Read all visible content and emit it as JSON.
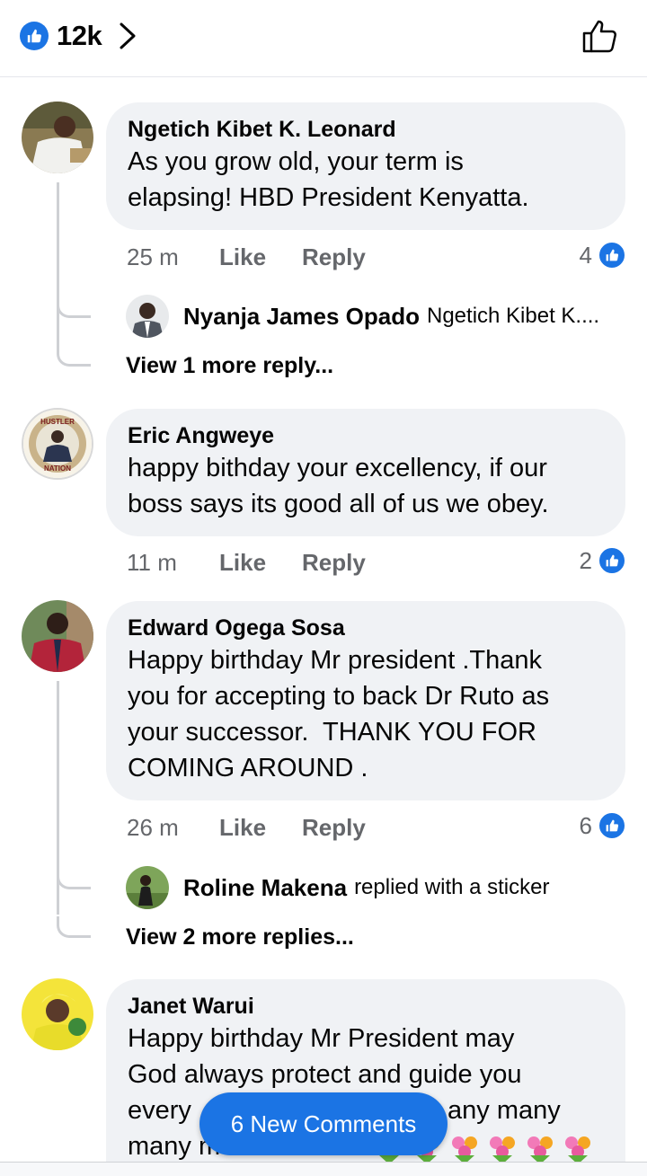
{
  "header": {
    "reaction_count": "12k",
    "like_icon": "like-thumb-icon",
    "chevron_icon": "chevron-right-icon",
    "like_button_icon": "thumb-up-outline-icon"
  },
  "colors": {
    "accent": "#1b74e4",
    "bubble": "#f0f2f5",
    "meta": "#65676b",
    "thread": "#ced0d4"
  },
  "comments": [
    {
      "author": "Ngetich Kibet K. Leonard",
      "lines": [
        "As you grow old, your term is",
        "elapsing! HBD President Kenyatta."
      ],
      "time": "25 m",
      "like": "Like",
      "reply": "Reply",
      "reactions": "4"
    },
    {
      "author": "Eric Angweye",
      "lines": [
        "happy bithday your excellency, if our",
        "boss says its good all of us we obey."
      ],
      "time": "11 m",
      "like": "Like",
      "reply": "Reply",
      "reactions": "2"
    },
    {
      "author": "Edward Ogega Sosa",
      "lines": [
        "Happy birthday Mr president .Thank",
        "you for accepting to back Dr Ruto as",
        "your successor.  THANK YOU FOR",
        "COMING AROUND ."
      ],
      "time": "26 m",
      "like": "Like",
      "reply": "Reply",
      "reactions": "6"
    },
    {
      "author": "Janet Warui",
      "lines": [
        "Happy birthday Mr President may",
        "God always protect and guide you",
        "every",
        "any many",
        "many more cheers"
      ]
    }
  ],
  "replies": [
    {
      "name": "Nyanja James Opado",
      "snippet": "Ngetich Kibet K...."
    },
    {
      "name": "Roline Makena",
      "snippet": "replied with a sticker"
    }
  ],
  "view_more": [
    "View 1 more reply...",
    "View 2 more replies..."
  ],
  "new_comments_label": "6 New Comments"
}
